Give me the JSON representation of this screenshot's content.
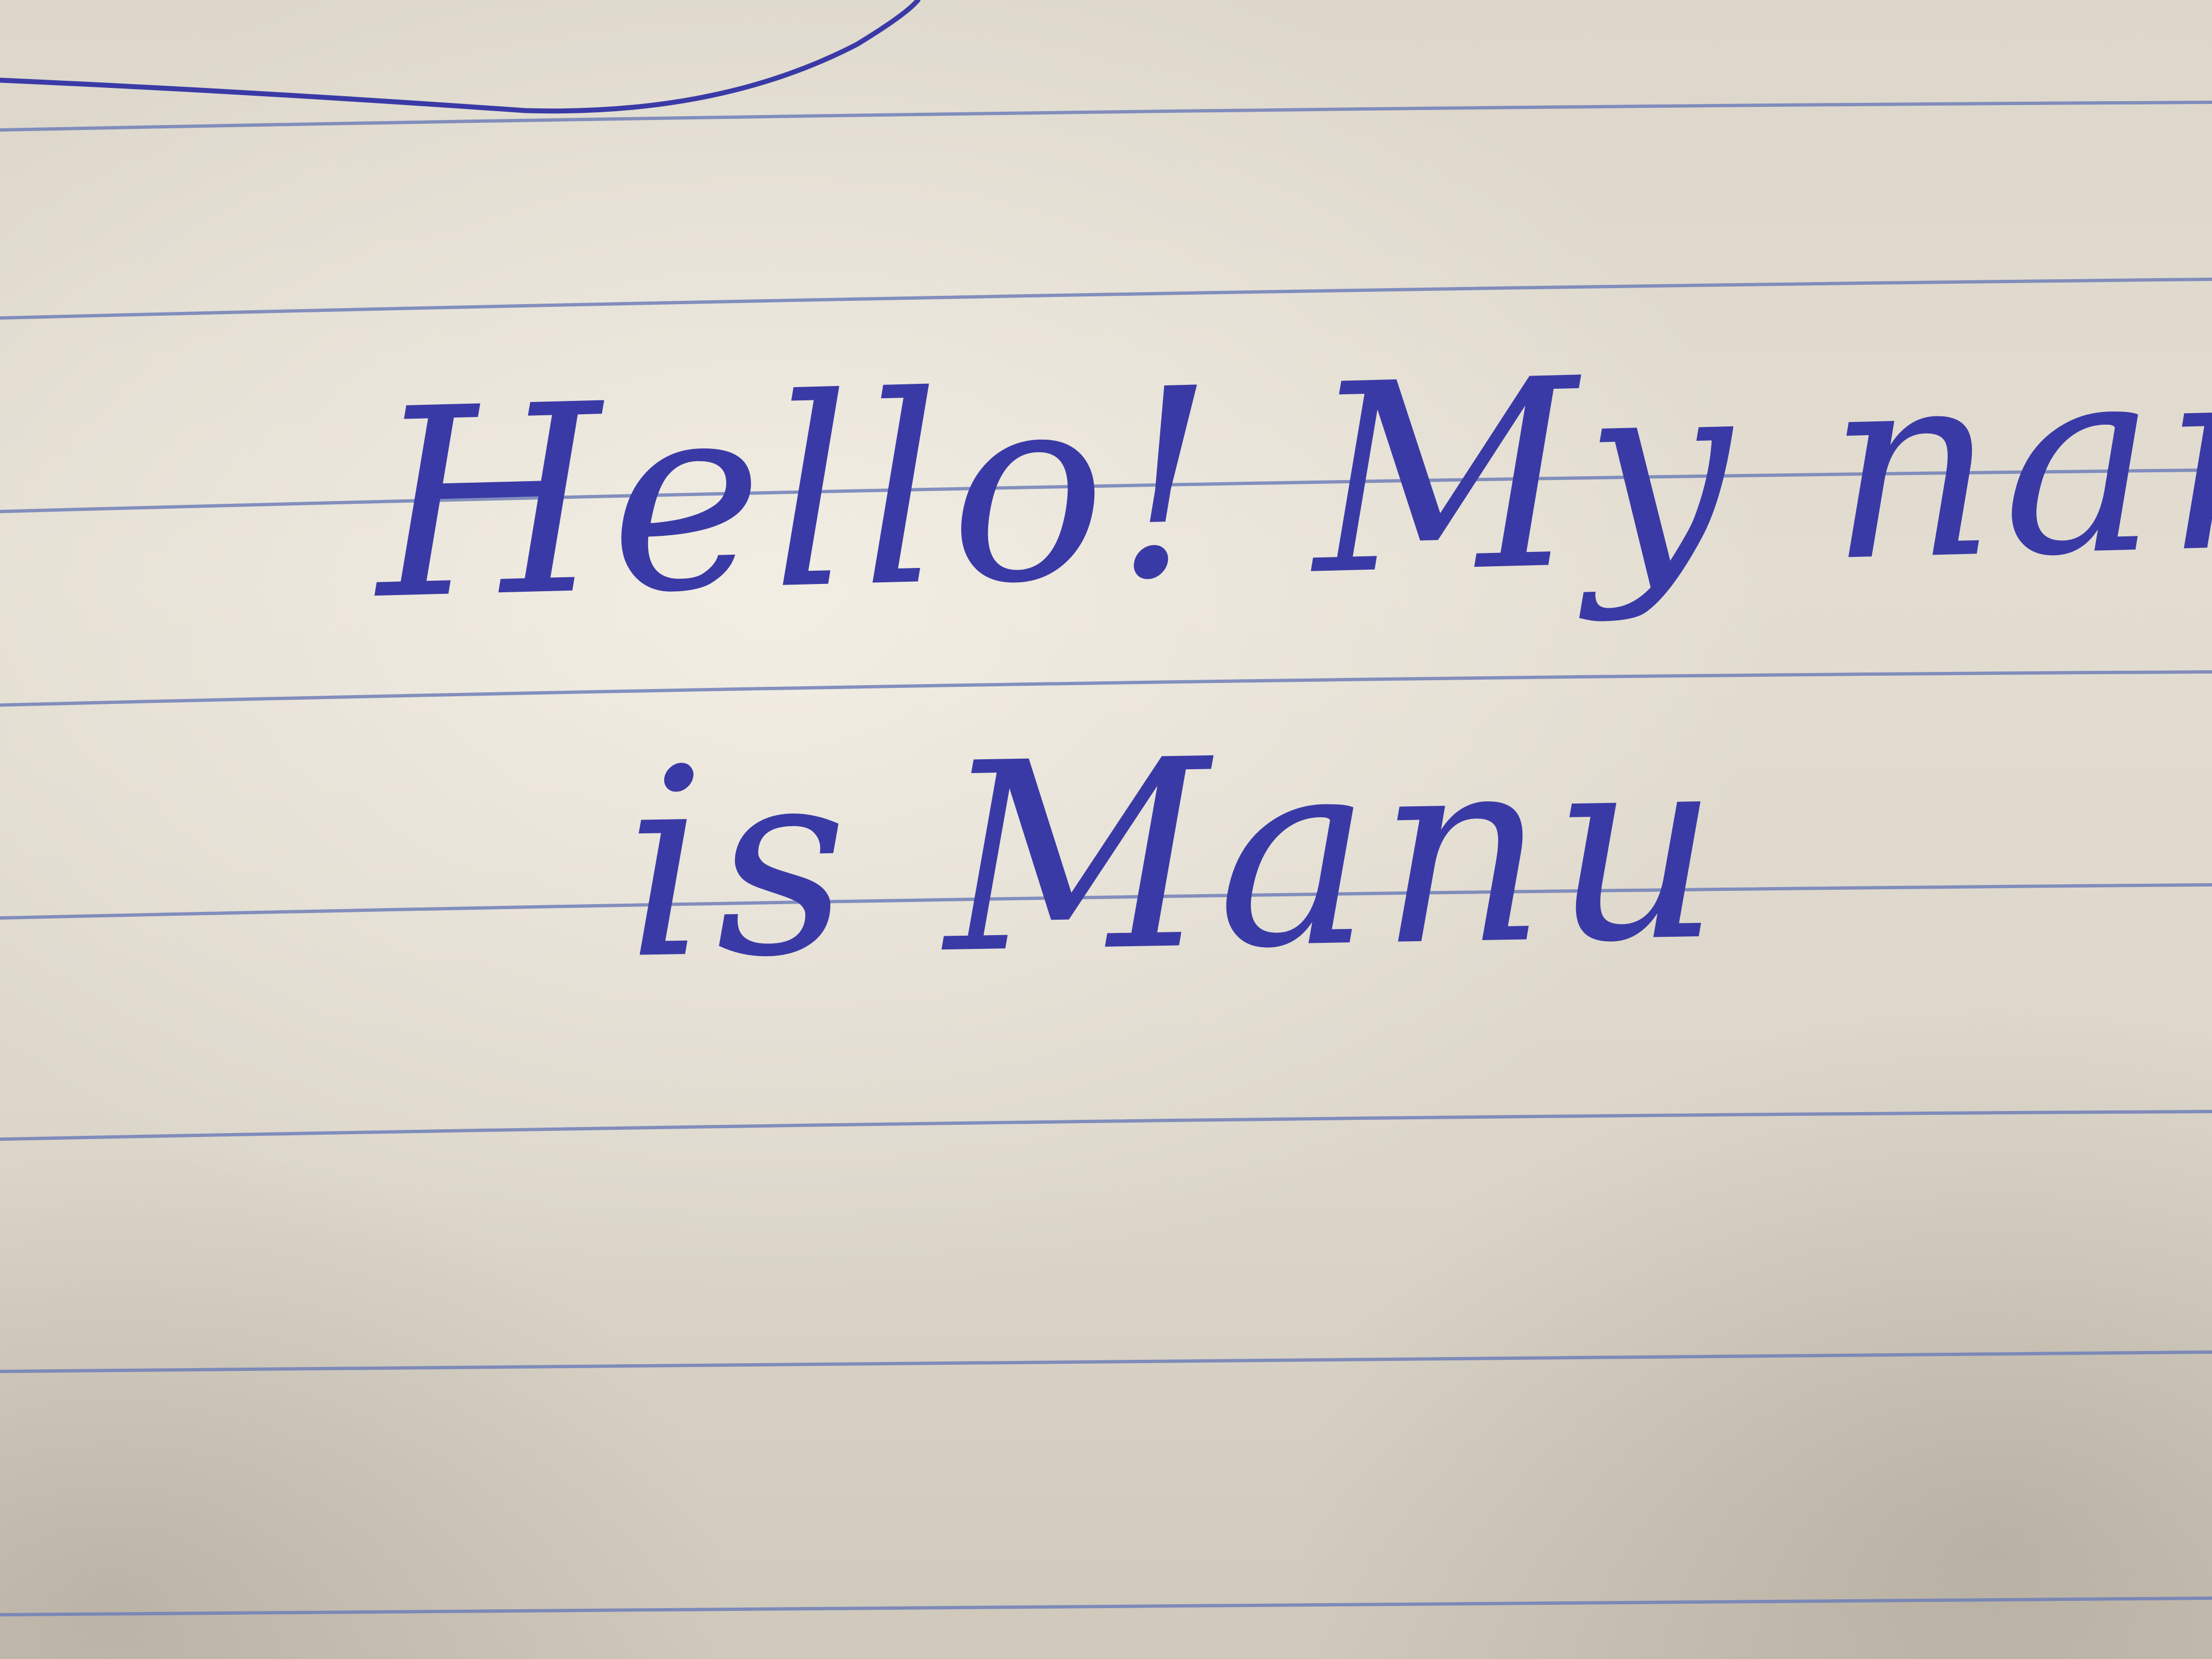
{
  "note": {
    "line_1": "Hello! My name",
    "line_2": "is Manu"
  },
  "colors": {
    "ink": "#3a3aa6",
    "ruling": "#6f7fb8",
    "paper": "#ddd7cb"
  }
}
